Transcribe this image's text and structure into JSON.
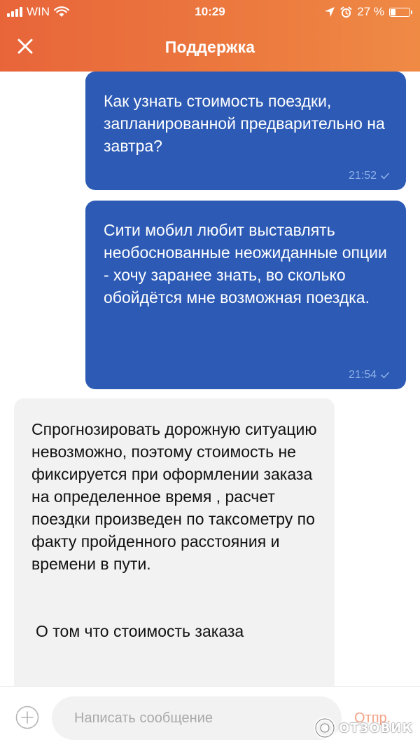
{
  "status_bar": {
    "carrier": "WIN",
    "time": "10:29",
    "battery_percent": "27 %",
    "battery_level": 0.27
  },
  "nav": {
    "title": "Поддержка",
    "close_icon": "close-icon"
  },
  "messages": [
    {
      "direction": "outgoing",
      "text": "Как узнать стоимость поездки, запланированной предварительно на завтра?",
      "time": "21:52"
    },
    {
      "direction": "outgoing",
      "text": "Сити мобил любит выставлять необоснованные неожиданные опции - хочу заранее знать, во сколько обойдётся мне возможная поездка.",
      "time": "21:54"
    },
    {
      "direction": "incoming",
      "text": "Спрогнозировать дорожную ситуацию невозможно, поэтому стоимость не фиксируется при оформлении заказа на определенное время , расчет поездки произведен по таксометру по факту пройденного расстояния и времени в пути.",
      "text2": "О том что стоимость заказа"
    }
  ],
  "composer": {
    "placeholder": "Написать сообщение",
    "send_label": "Отпр."
  },
  "watermark": {
    "text": "ОТЗОВИК"
  },
  "colors": {
    "header_start": "#e8653a",
    "header_end": "#ef8a45",
    "outgoing_bubble": "#2c5ab5",
    "incoming_bubble": "#f2f2f2",
    "send_label": "#f3a387"
  }
}
